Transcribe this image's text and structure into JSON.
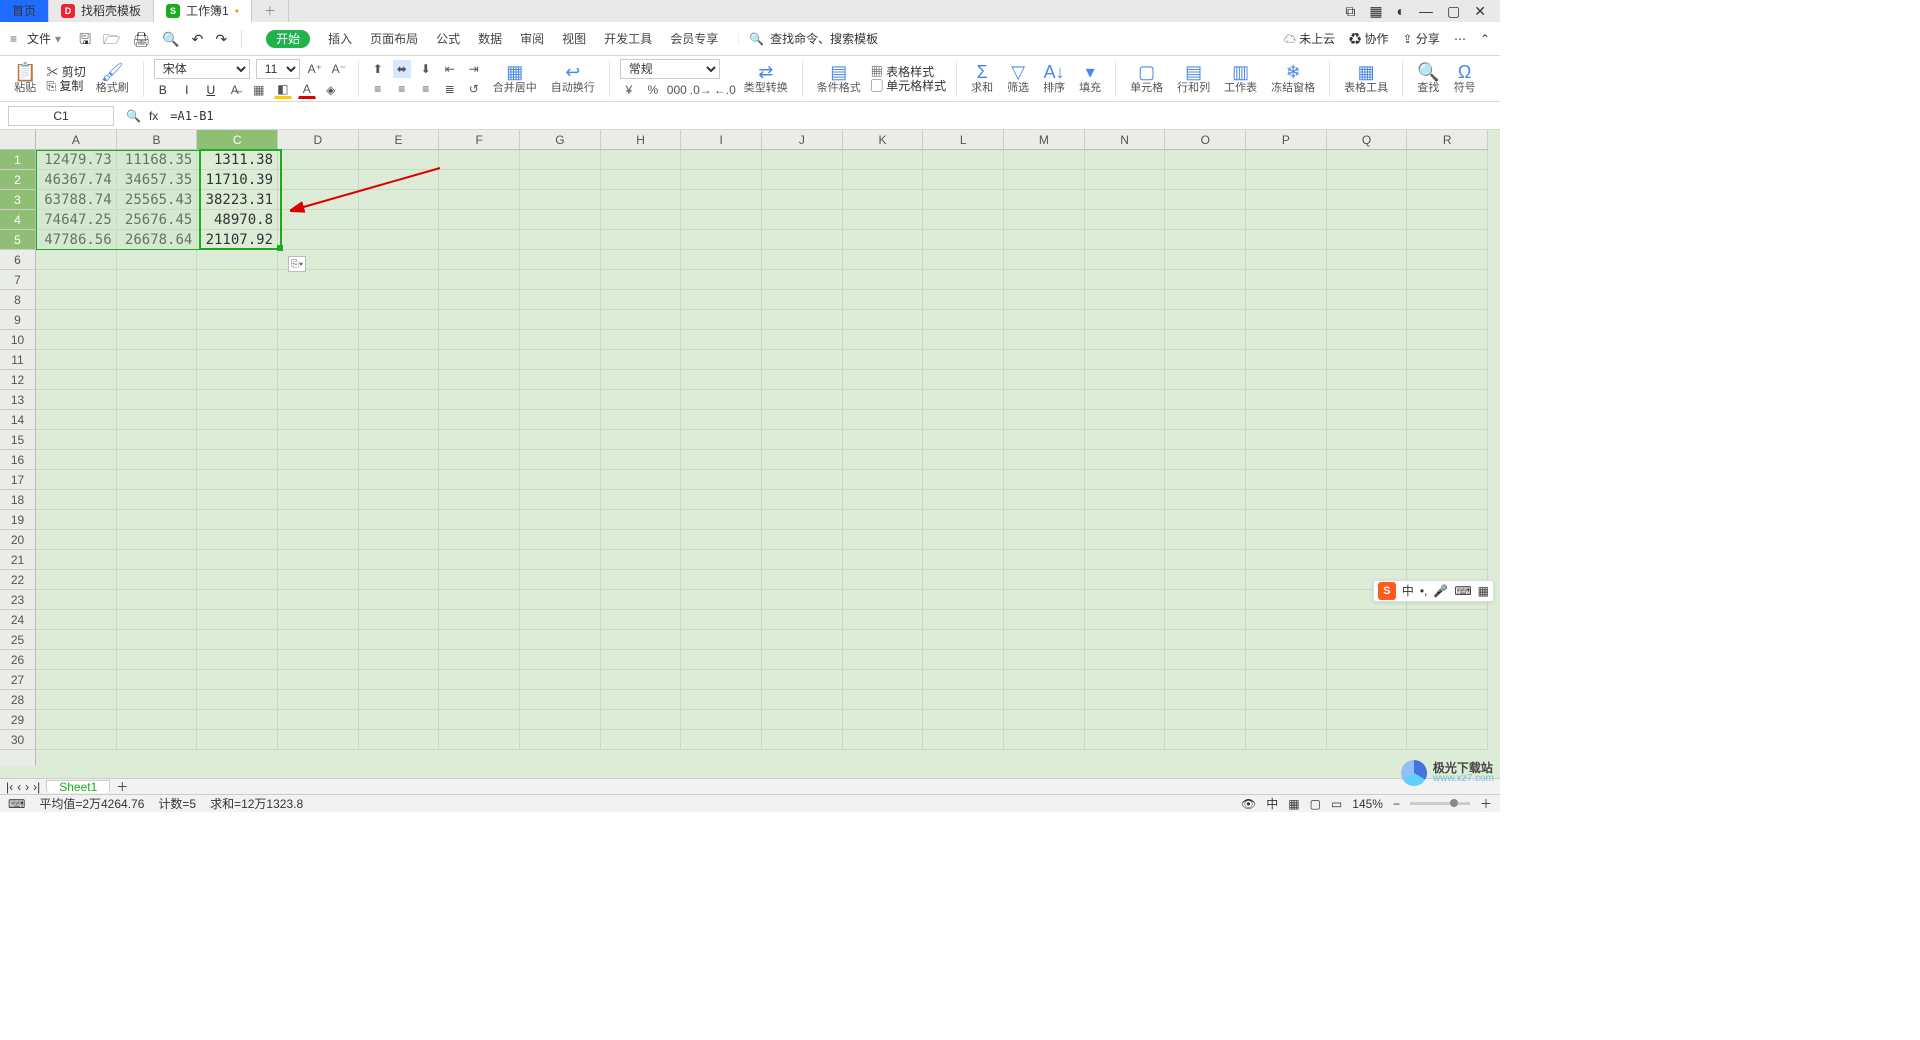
{
  "title_tabs": {
    "home": "首页",
    "template": "找稻壳模板",
    "workbook": "工作簿1"
  },
  "menu": {
    "file": "文件",
    "tabs": [
      "开始",
      "插入",
      "页面布局",
      "公式",
      "数据",
      "审阅",
      "视图",
      "开发工具",
      "会员专享"
    ],
    "search_placeholder": "查找命令、搜索模板",
    "cloud": "未上云",
    "coop": "协作",
    "share": "分享"
  },
  "ribbon": {
    "paste": "粘贴",
    "cut": "剪切",
    "copy": "复制",
    "format_painter": "格式刷",
    "font_name": "宋体",
    "font_size": "11",
    "merge": "合并居中",
    "wrap": "自动换行",
    "number_format": "常规",
    "type_convert": "类型转换",
    "cond_fmt": "条件格式",
    "table_style": "表格样式",
    "cell_style": "单元格样式",
    "sum": "求和",
    "filter": "筛选",
    "sort": "排序",
    "fill": "填充",
    "cell": "单元格",
    "rowcol": "行和列",
    "sheet": "工作表",
    "freeze": "冻结窗格",
    "table_tool": "表格工具",
    "find": "查找",
    "symbol": "符号"
  },
  "formula_bar": {
    "cell_name": "C1",
    "formula": "=A1-B1"
  },
  "grid": {
    "cols": [
      "A",
      "B",
      "C",
      "D",
      "E",
      "F",
      "G",
      "H",
      "I",
      "J",
      "K",
      "L",
      "M",
      "N",
      "O",
      "P",
      "Q",
      "R"
    ],
    "selected_col": "C",
    "data": [
      [
        "12479.73",
        "11168.35",
        "1311.38"
      ],
      [
        "46367.74",
        "34657.35",
        "11710.39"
      ],
      [
        "63788.74",
        "25565.43",
        "38223.31"
      ],
      [
        "74647.25",
        "25676.45",
        "48970.8"
      ],
      [
        "47786.56",
        "26678.64",
        "21107.92"
      ]
    ],
    "selected_rows": 5
  },
  "sheet_tabs": {
    "active": "Sheet1"
  },
  "status": {
    "avg": "平均值=2万4264.76",
    "count": "计数=5",
    "sum": "求和=12万1323.8",
    "zoom": "145%"
  },
  "watermark": {
    "name": "极光下载站",
    "url": "www.xz7.com"
  },
  "ime": {
    "lang": "中"
  }
}
